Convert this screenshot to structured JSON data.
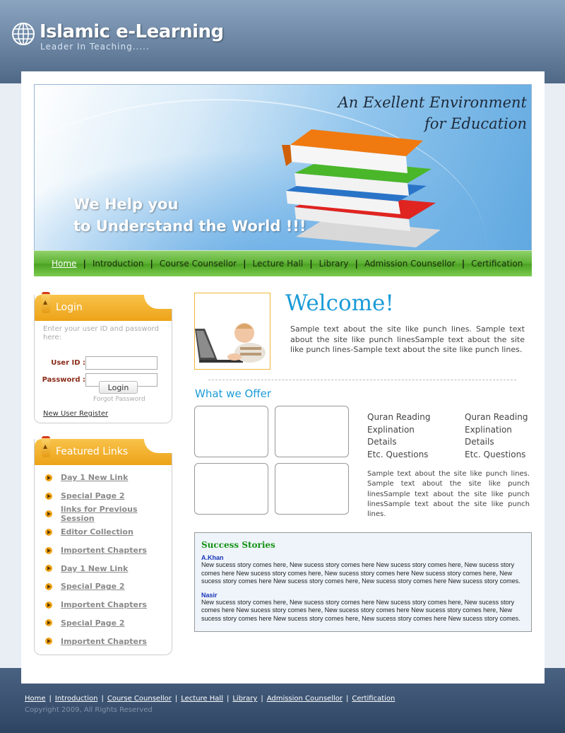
{
  "brand": {
    "title": "Islamic e-Learning",
    "subtitle": "Leader In Teaching....."
  },
  "banner": {
    "tagline_line1": "An Exellent Environment",
    "tagline_line2": "for Education",
    "headline_line1": "We Help you",
    "headline_line2": "to Understand the World !!!"
  },
  "nav": {
    "items": [
      "Home",
      "Introduction",
      "Course Counsellor",
      "Lecture Hall",
      "Library",
      "Admission Counsellor",
      "Certification"
    ],
    "active": "Home"
  },
  "login": {
    "title": "Login",
    "hint": "Enter your user ID and password here:",
    "userid_label": "User ID :",
    "password_label": "Password :",
    "userid_value": "",
    "password_value": "",
    "button": "Login",
    "forgot": "Forgot Password",
    "register": "New User Register"
  },
  "featured": {
    "title": "Featured Links",
    "links": [
      "Day 1 New Link",
      "Special Page 2",
      "links for Previous Session",
      "Editor Collection",
      "Importent Chapters",
      "Day 1 New Link",
      "Special Page 2",
      "Importent Chapters",
      "Special Page 2",
      "Importent Chapters"
    ]
  },
  "welcome": {
    "title": "Welcome!",
    "text": "Sample text about the site like punch lines. Sample text about the site like punch linesSample text about the site like punch lines-Sample text about the site like punch lines."
  },
  "offer": {
    "title": "What we Offer",
    "col1": [
      "Quran Reading",
      "Explination",
      "Details",
      "Etc. Questions"
    ],
    "col2": [
      "Quran Reading",
      "Explination",
      "Details",
      "Etc. Questions"
    ],
    "text": "Sample text about the site like punch lines. Sample text about the site like punch linesSample text about the site like punch linesSample text about the site like punch lines."
  },
  "success": {
    "title": "Success Stories",
    "stories": [
      {
        "name": "A.Khan",
        "text": "New sucess story comes here, New sucess story comes here  New sucess story comes here, New sucess story comes here New sucess story comes here, New sucess story comes here New sucess story comes here, New sucess story comes here New sucess story comes here, New sucess story comes here New sucess story comes."
      },
      {
        "name": "Nasir",
        "text": "New sucess story comes here, New sucess story comes here  New sucess story comes here, New sucess story comes here New sucess story comes here, New sucess story comes here New sucess story comes here, New sucess story comes here New sucess story comes here, New sucess story comes here New sucess story comes."
      }
    ]
  },
  "footer": {
    "links": [
      "Home",
      "Introduction",
      "Course Counsellor",
      "Lecture Hall",
      "Library",
      "Admission Counsellor",
      "Certification"
    ],
    "copyright": "Copyright 2009, All Rights Reserved"
  },
  "colors": {
    "accent_blue": "#1a9bd7",
    "nav_green": "#5bb131",
    "box_orange": "#eda318",
    "success_green": "#149314"
  }
}
